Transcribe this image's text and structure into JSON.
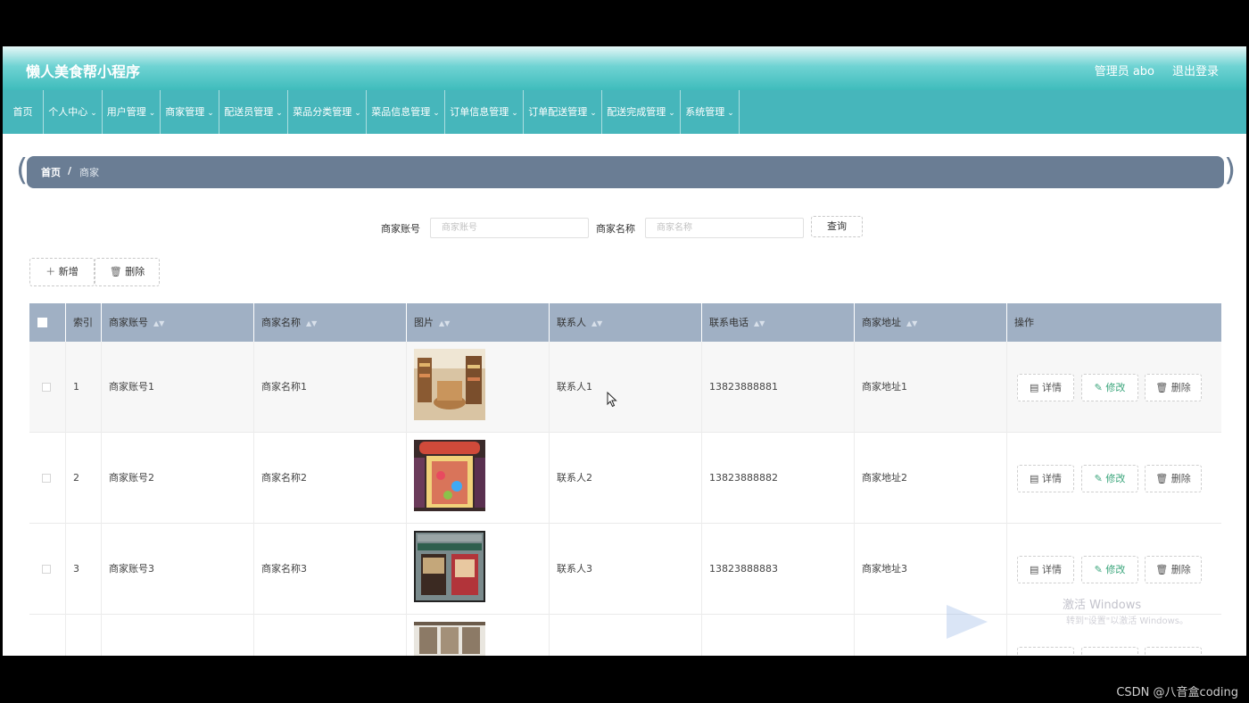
{
  "app": {
    "title": "懒人美食帮小程序",
    "admin_label": "管理员 abo",
    "logout": "退出登录"
  },
  "nav": [
    {
      "label": "首页"
    },
    {
      "label": "个人中心"
    },
    {
      "label": "用户管理"
    },
    {
      "label": "商家管理"
    },
    {
      "label": "配送员管理"
    },
    {
      "label": "菜品分类管理"
    },
    {
      "label": "菜品信息管理"
    },
    {
      "label": "订单信息管理"
    },
    {
      "label": "订单配送管理"
    },
    {
      "label": "配送完成管理"
    },
    {
      "label": "系统管理"
    }
  ],
  "breadcrumb": {
    "home": "首页",
    "sep": "/",
    "current": "商家"
  },
  "search": {
    "account_label": "商家账号",
    "account_placeholder": "商家账号",
    "account_value": "",
    "name_label": "商家名称",
    "name_placeholder": "商家名称",
    "name_value": "",
    "query_button": "查询"
  },
  "toolbar": {
    "add_label": "新增",
    "delete_label": "删除"
  },
  "table": {
    "headers": {
      "index": "索引",
      "account": "商家账号",
      "name": "商家名称",
      "image": "图片",
      "contact": "联系人",
      "phone": "联系电话",
      "address": "商家地址",
      "actions": "操作"
    },
    "rows": [
      {
        "index": "1",
        "account": "商家账号1",
        "name": "商家名称1",
        "contact": "联系人1",
        "phone": "13823888881",
        "address": "商家地址1"
      },
      {
        "index": "2",
        "account": "商家账号2",
        "name": "商家名称2",
        "contact": "联系人2",
        "phone": "13823888882",
        "address": "商家地址2"
      },
      {
        "index": "3",
        "account": "商家账号3",
        "name": "商家名称3",
        "contact": "联系人3",
        "phone": "13823888883",
        "address": "商家地址3"
      }
    ],
    "row_actions": {
      "detail": "详情",
      "edit": "修改",
      "delete": "删除"
    }
  },
  "overlay": {
    "activate_title": "激活 Windows",
    "activate_hint": "转到\"设置\"以激活 Windows。",
    "credit": "CSDN @八音盒coding"
  },
  "colors": {
    "teal": "#46b6bb",
    "breadcrumb": "#6a7d94",
    "table_header": "#a0b0c4",
    "edit_green": "#3aa57b"
  }
}
